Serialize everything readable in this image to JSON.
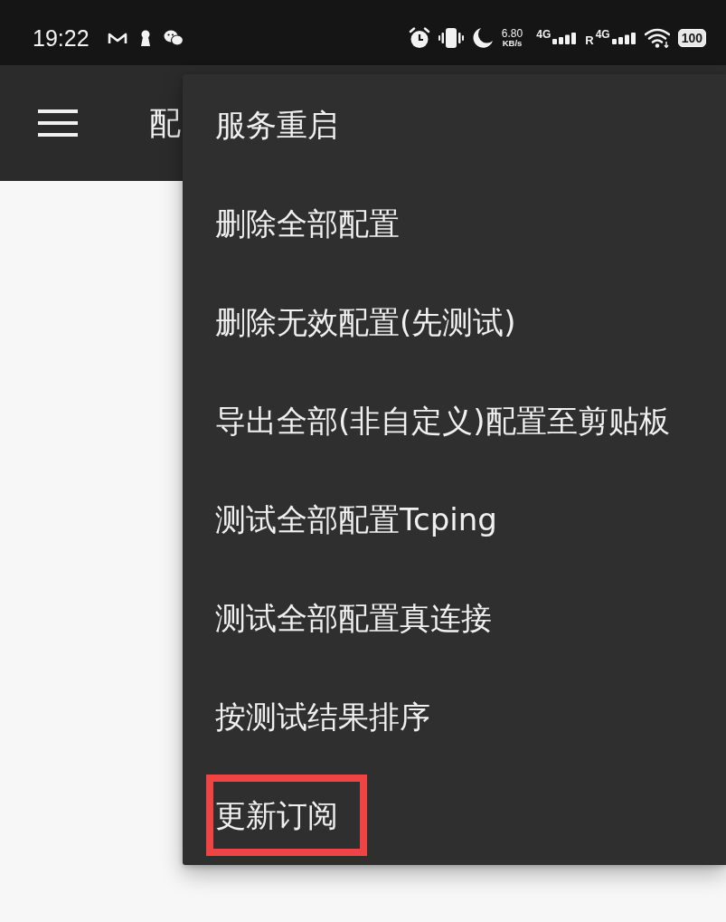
{
  "status_bar": {
    "time": "19:22",
    "network_speed": {
      "value": "6.80",
      "unit": "KB/s"
    },
    "sim_1": {
      "network": "4G"
    },
    "roaming": "R",
    "sim_2": {
      "network": "4G"
    },
    "battery": "100"
  },
  "toolbar": {
    "title": "配"
  },
  "menu": {
    "items": [
      {
        "label": "服务重启",
        "highlighted": false
      },
      {
        "label": "删除全部配置",
        "highlighted": false
      },
      {
        "label": "删除无效配置(先测试)",
        "highlighted": false
      },
      {
        "label": "导出全部(非自定义)配置至剪贴板",
        "highlighted": false
      },
      {
        "label": "测试全部配置Tcping",
        "highlighted": false
      },
      {
        "label": "测试全部配置真连接",
        "highlighted": false
      },
      {
        "label": "按测试结果排序",
        "highlighted": false
      },
      {
        "label": "更新订阅",
        "highlighted": true
      }
    ]
  }
}
